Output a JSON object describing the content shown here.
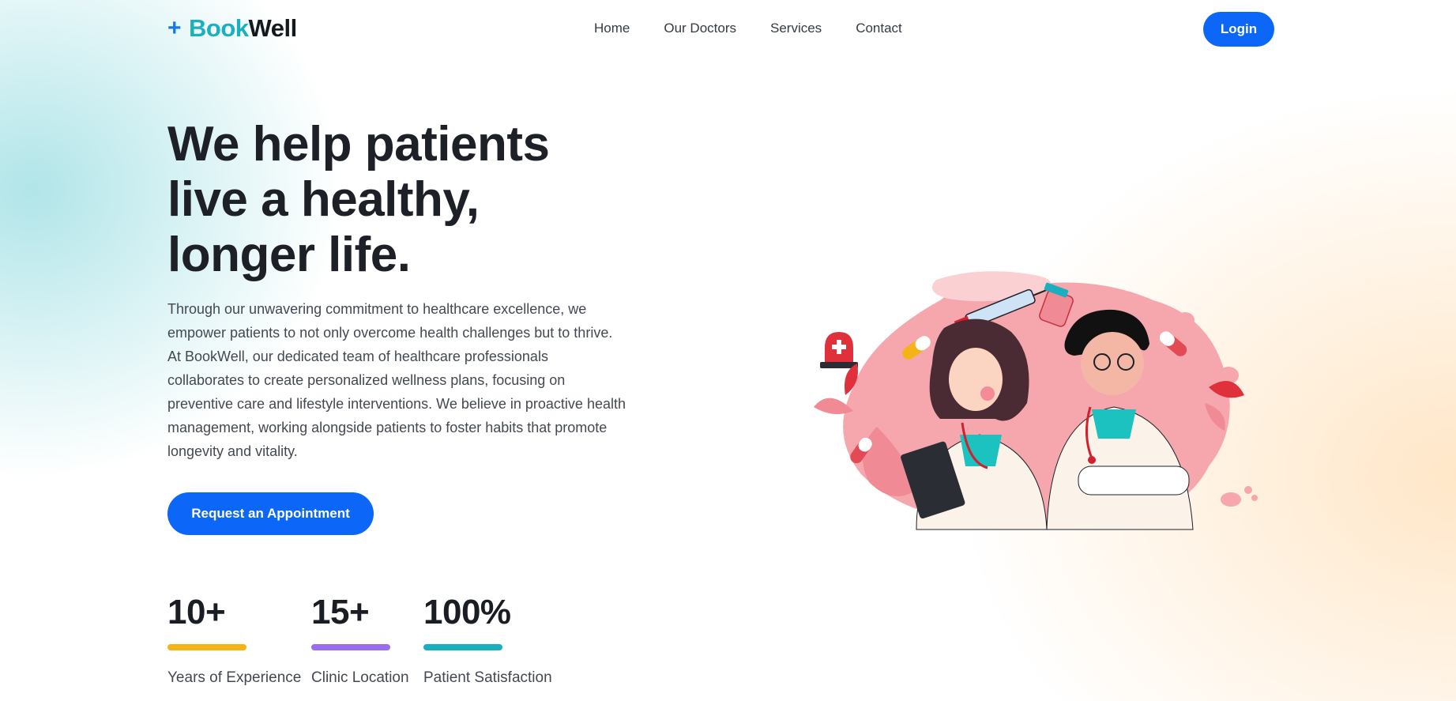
{
  "header": {
    "logo": {
      "icon": "plus-icon",
      "icon_glyph": "+",
      "part1": "Book",
      "part2": "Well"
    },
    "nav": [
      "Home",
      "Our Doctors",
      "Services",
      "Contact"
    ],
    "login_label": "Login"
  },
  "hero": {
    "headline_lines": [
      "We help patients",
      "live a healthy,",
      "longer life."
    ],
    "description": "Through our unwavering commitment to healthcare excellence, we empower patients to not only overcome health challenges but to thrive. At BookWell, our dedicated team of healthcare professionals collaborates to create personalized wellness plans, focusing on preventive care and lifestyle interventions. We believe in proactive health management, working alongside patients to foster habits that promote longevity and vitality.",
    "cta_label": "Request an Appointment"
  },
  "stats": [
    {
      "value": "10+",
      "label": "Years of Experience",
      "color": "#f5b31a"
    },
    {
      "value": "15+",
      "label": "Clinic Location",
      "color": "#9a6cf0"
    },
    {
      "value": "100%",
      "label": "Patient Satisfaction",
      "color": "#1aaebf"
    }
  ],
  "illustration": {
    "name": "doctors-illustration"
  },
  "colors": {
    "primary": "#0c66f7",
    "brand_teal": "#1bb0c0",
    "text": "#1d2026"
  }
}
